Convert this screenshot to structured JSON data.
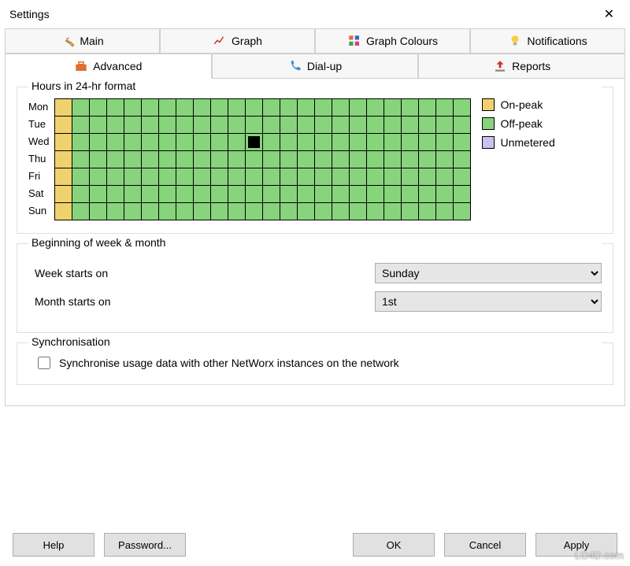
{
  "window": {
    "title": "Settings"
  },
  "tabs": {
    "row1": [
      {
        "label": "Main"
      },
      {
        "label": "Graph"
      },
      {
        "label": "Graph Colours"
      },
      {
        "label": "Notifications"
      }
    ],
    "row2": [
      {
        "label": "Advanced"
      },
      {
        "label": "Dial-up"
      },
      {
        "label": "Reports"
      }
    ],
    "active": "Advanced"
  },
  "hours": {
    "group_label": "Hours in 24-hr format",
    "days": [
      "Mon",
      "Tue",
      "Wed",
      "Thu",
      "Fri",
      "Sat",
      "Sun"
    ],
    "columns": 24,
    "cells_comment": "Column 0 is on-peak for all days; all others off-peak. Wed hour 11 is highlighted.",
    "onpeak_column": 0,
    "selected": {
      "day": 2,
      "hour": 11
    },
    "legend": {
      "onpeak": "On-peak",
      "offpeak": "Off-peak",
      "unmetered": "Unmetered"
    }
  },
  "week_month": {
    "group_label": "Beginning of week & month",
    "week_label": "Week starts on",
    "week_value": "Sunday",
    "month_label": "Month starts on",
    "month_value": "1st"
  },
  "sync": {
    "group_label": "Synchronisation",
    "checkbox_label": "Synchronise usage data with other NetWorx instances on the network",
    "checked": false
  },
  "buttons": {
    "help": "Help",
    "password": "Password...",
    "ok": "OK",
    "cancel": "Cancel",
    "apply": "Apply"
  },
  "watermark": "LO4D.com"
}
